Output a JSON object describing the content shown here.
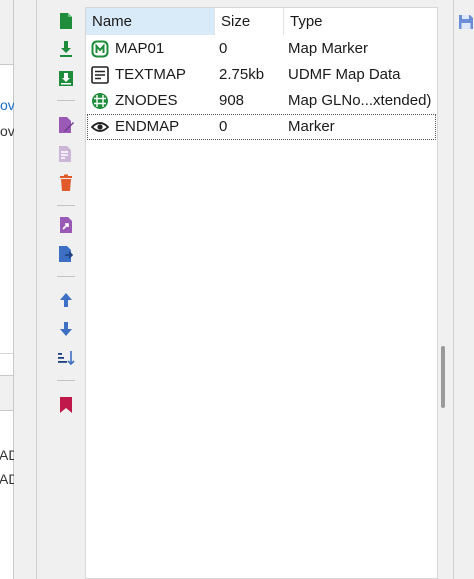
{
  "left_panel": {
    "link1": "ov",
    "link2": "ov",
    "text1": "AD",
    "text2": "AD"
  },
  "toolbar": {
    "buttons": [
      {
        "name": "new-entry",
        "icon": "new-file-icon"
      },
      {
        "name": "import",
        "icon": "import-icon"
      },
      {
        "name": "import-files",
        "icon": "import-files-icon"
      },
      {
        "name": "rename",
        "icon": "rename-icon"
      },
      {
        "name": "rename-disabled",
        "icon": "rename-disabled-icon"
      },
      {
        "name": "delete",
        "icon": "delete-icon"
      },
      {
        "name": "export",
        "icon": "export-icon"
      },
      {
        "name": "export-as",
        "icon": "export-as-icon"
      },
      {
        "name": "move-up",
        "icon": "arrow-up-icon"
      },
      {
        "name": "move-down",
        "icon": "arrow-down-icon"
      },
      {
        "name": "sort",
        "icon": "sort-icon"
      },
      {
        "name": "bookmark",
        "icon": "bookmark-icon"
      }
    ]
  },
  "list": {
    "columns": [
      "Name",
      "Size",
      "Type"
    ],
    "rows": [
      {
        "icon": "map-marker-icon",
        "name": "MAP01",
        "size": "0",
        "type": "Map Marker"
      },
      {
        "icon": "text-data-icon",
        "name": "TEXTMAP",
        "size": "2.75kb",
        "type": "UDMF Map Data"
      },
      {
        "icon": "nodes-icon",
        "name": "ZNODES",
        "size": "908",
        "type": "Map GLNo...xtended)"
      },
      {
        "icon": "marker-eye-icon",
        "name": "ENDMAP",
        "size": "0",
        "type": "Marker"
      }
    ]
  },
  "colors": {
    "green": "#1e8c3a",
    "purple": "#9b59b6",
    "red": "#e05a2b",
    "blue": "#3d6fc4",
    "crimson": "#c0184a",
    "header_selected": "#d9ebf9"
  }
}
